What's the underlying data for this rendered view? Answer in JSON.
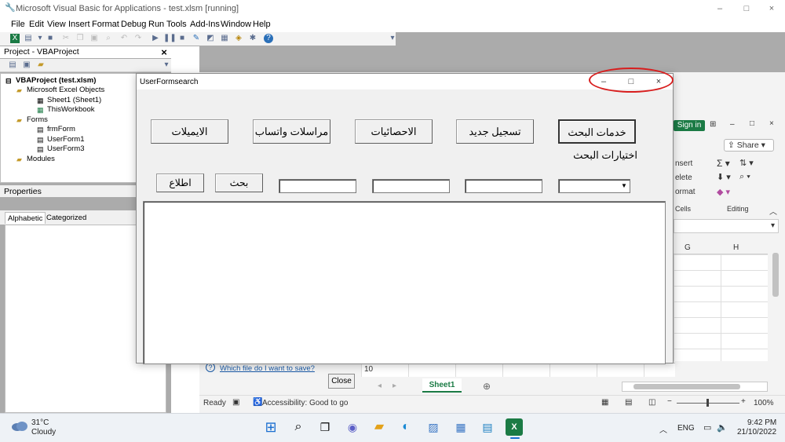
{
  "window": {
    "title": "Microsoft Visual Basic for Applications - test.xlsm [running]",
    "controls": {
      "minimize": "–",
      "maximize": "□",
      "close": "×"
    }
  },
  "menubar": [
    "File",
    "Edit",
    "View",
    "Insert",
    "Format",
    "Debug",
    "Run",
    "Tools",
    "Add-Ins",
    "Window",
    "Help"
  ],
  "project_pane": {
    "title": "Project - VBAProject",
    "close": "×",
    "tree": [
      {
        "label": "VBAProject (test.xlsm)",
        "bold": true,
        "indent": 0
      },
      {
        "label": "Microsoft Excel Objects",
        "indent": 1
      },
      {
        "label": "Sheet1 (Sheet1)",
        "indent": 2
      },
      {
        "label": "ThisWorkbook",
        "indent": 2
      },
      {
        "label": "Forms",
        "indent": 1
      },
      {
        "label": "frmForm",
        "indent": 2
      },
      {
        "label": "UserForm1",
        "indent": 2
      },
      {
        "label": "UserForm3",
        "indent": 2
      },
      {
        "label": "Modules",
        "indent": 1
      }
    ]
  },
  "properties_pane": {
    "title": "Properties",
    "tabs": [
      "Alphabetic",
      "Categorized"
    ]
  },
  "userform": {
    "title": "UserFormsearch",
    "controls": {
      "minimize": "–",
      "maximize": "□",
      "close": "×"
    },
    "buttons_row1": [
      "الايميلات",
      "مراسلات واتساب",
      "الاحصائيات",
      "تسجيل جديد",
      "خدمات البحث"
    ],
    "label": "اختيارات البحث",
    "buttons_row2": [
      "اطلاع",
      "بحث"
    ],
    "combo_arrow": "▼"
  },
  "excel": {
    "sign_in": "Sign in",
    "share": "Share",
    "ribbon": [
      "nsert",
      "elete",
      "ormat",
      "Cells",
      "Editing"
    ],
    "columns": [
      "G",
      "H"
    ],
    "row_number": "10",
    "help_link": "Which file do I want to save?",
    "close_button": "Close",
    "sheet_tab": "Sheet1",
    "status_ready": "Ready",
    "accessibility": "Accessibility: Good to go",
    "zoom": "100%"
  },
  "taskbar": {
    "temperature": "31°C",
    "weather": "Cloudy",
    "language": "ENG",
    "time": "9:42 PM",
    "date": "21/10/2022"
  }
}
